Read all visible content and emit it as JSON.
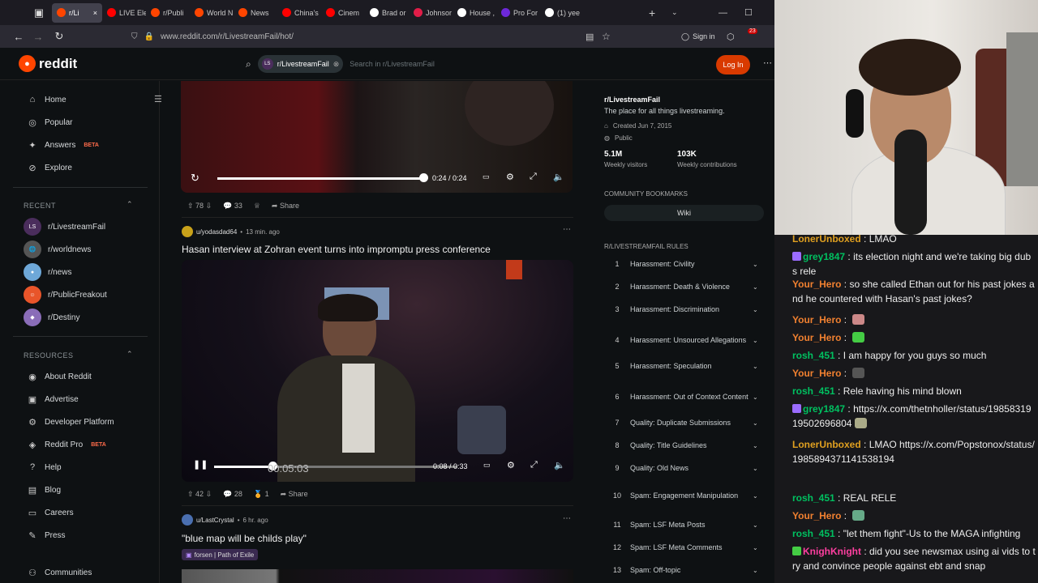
{
  "browser": {
    "tabs": [
      {
        "label": "r/Li",
        "color": "#ff4500",
        "active": true
      },
      {
        "label": "LIVE Ele",
        "color": "#ff0000"
      },
      {
        "label": "r/Publi",
        "color": "#ff4500"
      },
      {
        "label": "World N",
        "color": "#ff4500"
      },
      {
        "label": "News",
        "color": "#ff4500"
      },
      {
        "label": "China's",
        "color": "#ff0000"
      },
      {
        "label": "Cinem",
        "color": "#ff0000"
      },
      {
        "label": "Brad or",
        "color": "#ffffff"
      },
      {
        "label": "Johnsor",
        "color": "#e11d48"
      },
      {
        "label": "House ,",
        "color": "#ffffff"
      },
      {
        "label": "Pro For",
        "color": "#6d28d9"
      },
      {
        "label": "(1) yee",
        "color": "#ffffff"
      }
    ],
    "url": "www.reddit.com/r/LivestreamFail/hot/",
    "signin_label": "Sign in",
    "badge_count": "23"
  },
  "reddit": {
    "logo_text": "reddit",
    "search_chip": "r/LivestreamFail",
    "search_placeholder": "Search in r/LivestreamFail",
    "login_label": "Log In",
    "nav": [
      {
        "label": "Home",
        "icon": "home-icon",
        "glyph": "⌂"
      },
      {
        "label": "Popular",
        "icon": "popular-icon",
        "glyph": "◎"
      },
      {
        "label": "Answers",
        "icon": "answers-icon",
        "glyph": "✦",
        "beta": "BETA"
      },
      {
        "label": "Explore",
        "icon": "explore-icon",
        "glyph": "⊘"
      }
    ],
    "recent_label": "RECENT",
    "recent": [
      {
        "label": "r/LivestreamFail",
        "color": "#4a2d5c",
        "glyph": "LS"
      },
      {
        "label": "r/worldnews",
        "color": "#555555",
        "glyph": "🌐"
      },
      {
        "label": "r/news",
        "color": "#6ea8d8",
        "glyph": "●"
      },
      {
        "label": "r/PublicFreakout",
        "color": "#e8552a",
        "glyph": "☺"
      },
      {
        "label": "r/Destiny",
        "color": "#8a6db8",
        "glyph": "◆"
      }
    ],
    "resources_label": "RESOURCES",
    "resources": [
      {
        "label": "About Reddit",
        "icon": "about-icon",
        "glyph": "◉"
      },
      {
        "label": "Advertise",
        "icon": "advertise-icon",
        "glyph": "▣"
      },
      {
        "label": "Developer Platform",
        "icon": "developer-icon",
        "glyph": "⚙"
      },
      {
        "label": "Reddit Pro",
        "icon": "pro-icon",
        "glyph": "◈",
        "beta": "BETA"
      },
      {
        "label": "Help",
        "icon": "help-icon",
        "glyph": "?"
      },
      {
        "label": "Blog",
        "icon": "blog-icon",
        "glyph": "▤"
      },
      {
        "label": "Careers",
        "icon": "careers-icon",
        "glyph": "▭"
      },
      {
        "label": "Press",
        "icon": "press-icon",
        "glyph": "✎"
      }
    ],
    "communities_label": "Communities",
    "posts": [
      {
        "time": "0:24 / 0:24",
        "progress": 1.0,
        "votes": "78",
        "comments": "33",
        "share": "Share"
      },
      {
        "author": "u/yodasdad64",
        "age": "13 min. ago",
        "title": "Hasan interview at Zohran event turns into impromptu press conference",
        "time": "0:08 / 0:33",
        "progress": 0.24,
        "overlay_time": "00:05:03",
        "votes": "42",
        "comments": "28",
        "awards": "1",
        "share": "Share"
      },
      {
        "author": "u/LastCrystal",
        "age": "6 hr. ago",
        "title": "\"blue map will be childs play\"",
        "flair": "forsen | Path of Exile"
      }
    ],
    "community": {
      "name": "r/LivestreamFail",
      "description": "The place for all things livestreaming.",
      "created": "Created Jun 7, 2015",
      "visibility": "Public",
      "stats": [
        {
          "value": "5.1M",
          "label": "Weekly visitors"
        },
        {
          "value": "103K",
          "label": "Weekly contributions"
        }
      ],
      "bookmarks_label": "COMMUNITY BOOKMARKS",
      "wiki_label": "Wiki",
      "rules_label": "R/LIVESTREAMFAIL RULES",
      "rules": [
        {
          "n": "1",
          "text": "Harassment: Civility"
        },
        {
          "n": "2",
          "text": "Harassment: Death & Violence"
        },
        {
          "n": "3",
          "text": "Harassment: Discrimination"
        },
        {
          "n": "4",
          "text": "Harassment: Unsourced Allegations"
        },
        {
          "n": "5",
          "text": "Harassment: Speculation"
        },
        {
          "n": "6",
          "text": "Harassment: Out of Context Content"
        },
        {
          "n": "7",
          "text": "Quality: Duplicate Submissions"
        },
        {
          "n": "8",
          "text": "Quality: Title Guidelines"
        },
        {
          "n": "9",
          "text": "Quality: Old News"
        },
        {
          "n": "10",
          "text": "Spam: Engagement Manipulation"
        },
        {
          "n": "11",
          "text": "Spam: LSF Meta Posts"
        },
        {
          "n": "12",
          "text": "Spam: LSF Meta Comments"
        },
        {
          "n": "13",
          "text": "Spam: Off-topic"
        }
      ]
    }
  },
  "chat": [
    {
      "user": "LonerUnboxed",
      "color": "#e0a020",
      "text": "LMAO"
    },
    {
      "user": "grey1847",
      "color": "#00c060",
      "badge": "#9b6cff",
      "text": "its election night and we're taking big dubs rele"
    },
    {
      "user": "Your_Hero",
      "color": "#f08030",
      "text": "so she called Ethan out for his past jokes and he countered with Hasan's past jokes?"
    },
    {
      "user": "Your_Hero",
      "color": "#f08030",
      "text": "",
      "emote": "#c88"
    },
    {
      "user": "Your_Hero",
      "color": "#f08030",
      "text": "",
      "emote": "#4c4"
    },
    {
      "user": "rosh_451",
      "color": "#00c060",
      "text": "I am happy for you guys so much"
    },
    {
      "user": "Your_Hero",
      "color": "#f08030",
      "text": "",
      "emote": "#555"
    },
    {
      "user": "rosh_451",
      "color": "#00c060",
      "text": "Rele having his mind blown"
    },
    {
      "user": "grey1847",
      "color": "#00c060",
      "badge": "#9b6cff",
      "text": "https://x.com/thetnholler/status/1985831919502696804",
      "emote": "#aa8"
    },
    {
      "user": "LonerUnboxed",
      "color": "#e0a020",
      "text": "LMAO https://x.com/Popstonox/status/1985894371141538194"
    },
    {
      "user": "rosh_451",
      "color": "#00c060",
      "text": "REAL RELE"
    },
    {
      "user": "Your_Hero",
      "color": "#f08030",
      "text": "",
      "emote": "#6a8"
    },
    {
      "user": "rosh_451",
      "color": "#00c060",
      "text": "\"let them fight\"-Us to the MAGA infighting"
    },
    {
      "user": "KnighKnight",
      "color": "#ff3fa0",
      "badge": "#4c4",
      "text": "did you see newsmax using ai vids to try and convince people against ebt and snap"
    }
  ]
}
